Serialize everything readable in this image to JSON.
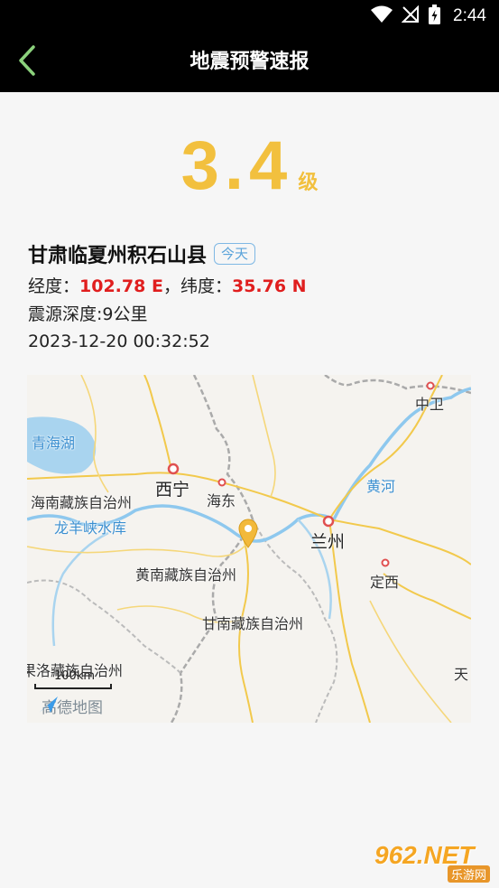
{
  "status_bar": {
    "time": "2:44"
  },
  "app_bar": {
    "title": "地震预警速报"
  },
  "quake": {
    "magnitude": "3.4",
    "magnitude_unit": "级",
    "location": "甘肃临夏州积石山县",
    "badge": "今天",
    "longitude_label": "经度：",
    "longitude": "102.78 E",
    "separator": "，",
    "latitude_label": "纬度：",
    "latitude": "35.76 N",
    "depth": "震源深度:9公里",
    "time": "2023-12-20 00:32:52"
  },
  "map": {
    "labels": {
      "qinghai_lake": "青海湖",
      "xining": "西宁",
      "haidong": "海东",
      "haibei": "海南藏族自治州",
      "longyangxia": "龙羊峡水库",
      "huangnan": "黄南藏族自治州",
      "lanzhou": "兰州",
      "huanghe": "黄河",
      "dingxi": "定西",
      "gannan": "甘南藏族自治州",
      "zhongwei": "中卫",
      "guoluo": "果洛藏族自治州",
      "tian": "天"
    },
    "scale": "100km",
    "provider": "高德地图"
  },
  "watermark": {
    "main": "962.NET",
    "sub": "乐游网"
  }
}
